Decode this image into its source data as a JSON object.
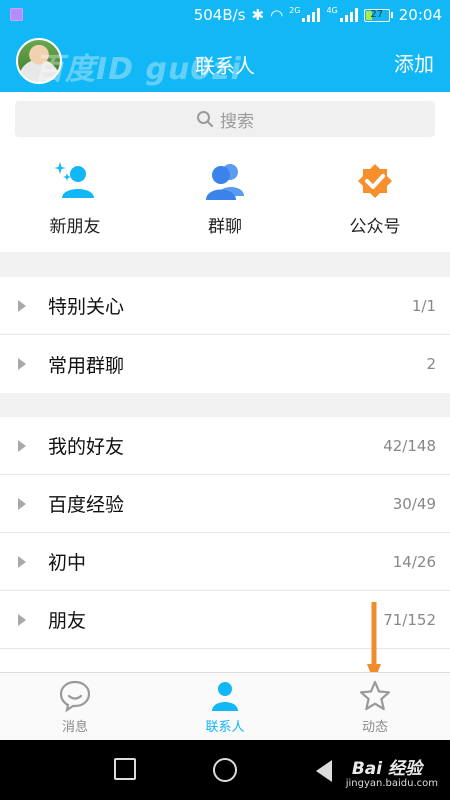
{
  "status_bar": {
    "speed": "504B/s",
    "network_2g": "2G",
    "network_4g": "4G",
    "battery": "27",
    "time": "20:04"
  },
  "header": {
    "watermark": "百度ID gu0zi",
    "title": "联系人",
    "add_label": "添加"
  },
  "search": {
    "placeholder": "搜索"
  },
  "quick_entries": [
    {
      "label": "新朋友",
      "icon": "new-friend-icon"
    },
    {
      "label": "群聊",
      "icon": "group-chat-icon"
    },
    {
      "label": "公众号",
      "icon": "official-account-icon"
    }
  ],
  "groups_top": [
    {
      "name": "特别关心",
      "count": "1/1"
    },
    {
      "name": "常用群聊",
      "count": "2"
    }
  ],
  "groups_main": [
    {
      "name": "我的好友",
      "count": "42/148"
    },
    {
      "name": "百度经验",
      "count": "30/49"
    },
    {
      "name": "初中",
      "count": "14/26"
    },
    {
      "name": "朋友",
      "count": "71/152"
    }
  ],
  "tabs": [
    {
      "label": "消息",
      "icon": "message-icon"
    },
    {
      "label": "联系人",
      "icon": "contacts-icon"
    },
    {
      "label": "动态",
      "icon": "star-icon"
    }
  ],
  "footer_watermark": {
    "brand": "Bai 经验",
    "url": "jingyan.baidu.com"
  },
  "colors": {
    "accent": "#12b7f5",
    "annotation": "#f08c2c",
    "badge": "#f7902c"
  }
}
